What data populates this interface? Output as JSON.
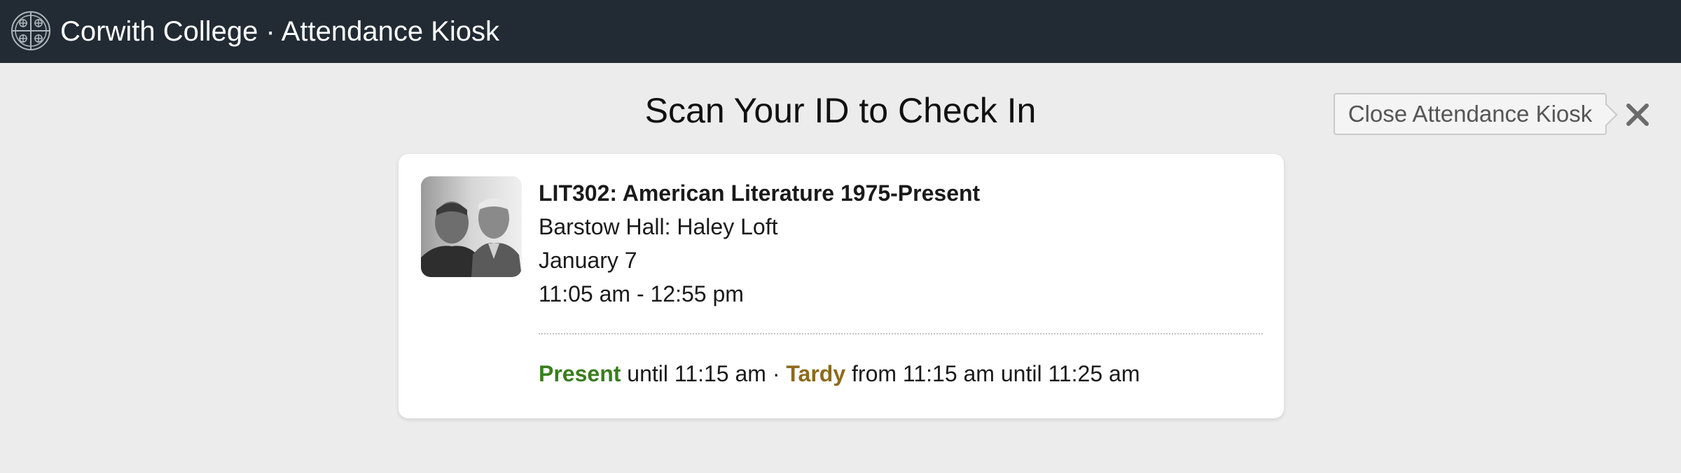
{
  "header": {
    "title": "Corwith College · Attendance Kiosk",
    "logo_icon": "college-seal-icon"
  },
  "main": {
    "heading": "Scan Your ID to Check In",
    "close_button_label": "Close Attendance Kiosk",
    "close_icon": "close-icon"
  },
  "session": {
    "course": "LIT302: American Literature 1975-Present",
    "location": "Barstow Hall: Haley Loft",
    "date": "January 7",
    "time": "11:05 am - 12:55 pm",
    "image": "course-photo",
    "status": {
      "present_label": "Present",
      "present_text": "until 11:15 am ·",
      "tardy_label": "Tardy",
      "tardy_text": "from 11:15 am until 11:25 am"
    }
  },
  "colors": {
    "topbar": "#222b33",
    "background": "#ececec",
    "present": "#3a7d1f",
    "tardy": "#8d6a1c"
  }
}
